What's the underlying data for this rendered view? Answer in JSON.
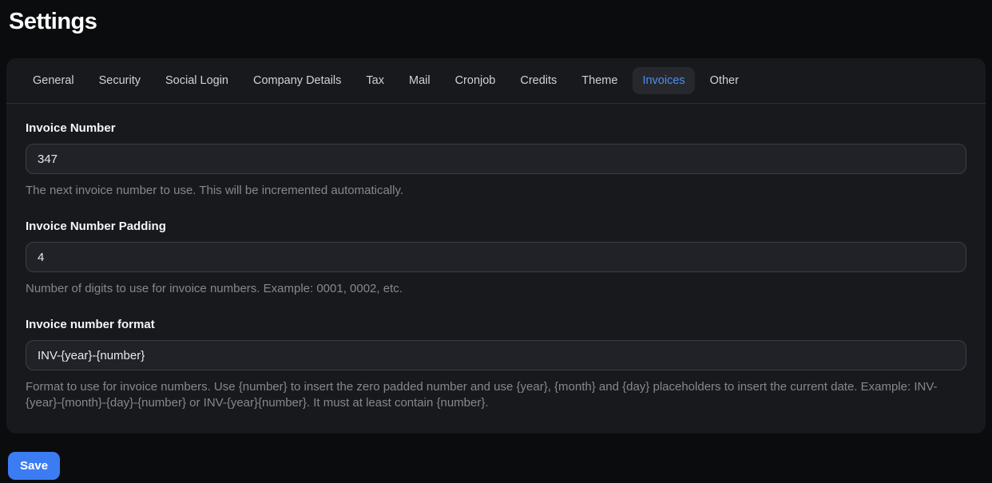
{
  "page": {
    "title": "Settings"
  },
  "colors": {
    "accent_blue": "#3b7cf2",
    "active_tab_text": "#4d8df6",
    "page_background": "#0b0c0e",
    "card_background": "#18191d"
  },
  "tabs": {
    "items": [
      {
        "label": "General",
        "active": false
      },
      {
        "label": "Security",
        "active": false
      },
      {
        "label": "Social Login",
        "active": false
      },
      {
        "label": "Company Details",
        "active": false
      },
      {
        "label": "Tax",
        "active": false
      },
      {
        "label": "Mail",
        "active": false
      },
      {
        "label": "Cronjob",
        "active": false
      },
      {
        "label": "Credits",
        "active": false
      },
      {
        "label": "Theme",
        "active": false
      },
      {
        "label": "Invoices",
        "active": true
      },
      {
        "label": "Other",
        "active": false
      }
    ]
  },
  "form": {
    "fields": [
      {
        "label": "Invoice Number",
        "value": "347",
        "help": "The next invoice number to use. This will be incremented automatically."
      },
      {
        "label": "Invoice Number Padding",
        "value": "4",
        "help": "Number of digits to use for invoice numbers. Example: 0001, 0002, etc."
      },
      {
        "label": "Invoice number format",
        "value": "INV-{year}-{number}",
        "help": "Format to use for invoice numbers. Use {number} to insert the zero padded number and use {year}, {month} and {day} placeholders to insert the current date. Example: INV-{year}-{month}-{day}-{number} or INV-{year}{number}. It must at least contain {number}."
      }
    ],
    "save_label": "Save"
  }
}
